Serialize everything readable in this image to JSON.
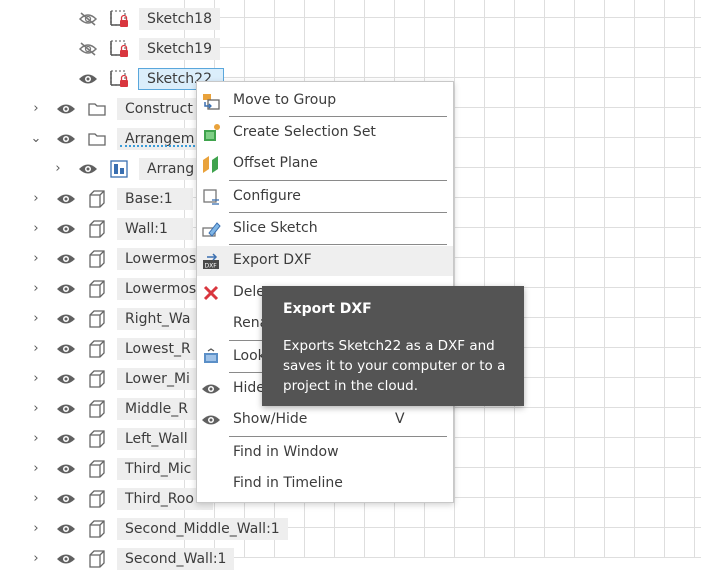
{
  "browser_tree": {
    "rows": [
      {
        "label": "Sketch18"
      },
      {
        "label": "Sketch19"
      },
      {
        "label": "Sketch22"
      },
      {
        "label": "Construct"
      },
      {
        "label": "Arrangem"
      },
      {
        "label": "Arrang"
      },
      {
        "label": "Base:1"
      },
      {
        "label": "Wall:1"
      },
      {
        "label": "Lowermos"
      },
      {
        "label": "Lowermos"
      },
      {
        "label": "Right_Wa"
      },
      {
        "label": "Lowest_R"
      },
      {
        "label": "Lower_Mi"
      },
      {
        "label": "Middle_R"
      },
      {
        "label": "Left_Wall"
      },
      {
        "label": "Third_Mic"
      },
      {
        "label": "Third_Roo"
      },
      {
        "label": "Second_Middle_Wall:1"
      },
      {
        "label": "Second_Wall:1"
      }
    ]
  },
  "context_menu": {
    "items": [
      {
        "label": "Move to Group",
        "icon": "move-to-group-icon"
      },
      {
        "label": "Create Selection Set",
        "icon": "selection-set-icon"
      },
      {
        "label": "Offset Plane",
        "icon": "offset-plane-icon"
      },
      {
        "label": "Configure",
        "icon": "configure-icon"
      },
      {
        "label": "Slice Sketch",
        "icon": "slice-sketch-icon"
      },
      {
        "label": "Export DXF",
        "icon": "export-dxf-icon"
      },
      {
        "label": "Dele",
        "icon": "delete-icon"
      },
      {
        "label": "Rena",
        "icon": ""
      },
      {
        "label": "Look",
        "icon": "look-at-icon"
      },
      {
        "label": "Hide",
        "icon": "eye-icon"
      },
      {
        "label": "Show/Hide",
        "shortcut": "V",
        "icon": "eye-icon"
      },
      {
        "label": "Find in Window",
        "icon": ""
      },
      {
        "label": "Find in Timeline",
        "icon": ""
      }
    ]
  },
  "tooltip": {
    "title": "Export DXF",
    "body": "Exports Sketch22 as a DXF and saves it to your computer or to a project in the cloud."
  }
}
